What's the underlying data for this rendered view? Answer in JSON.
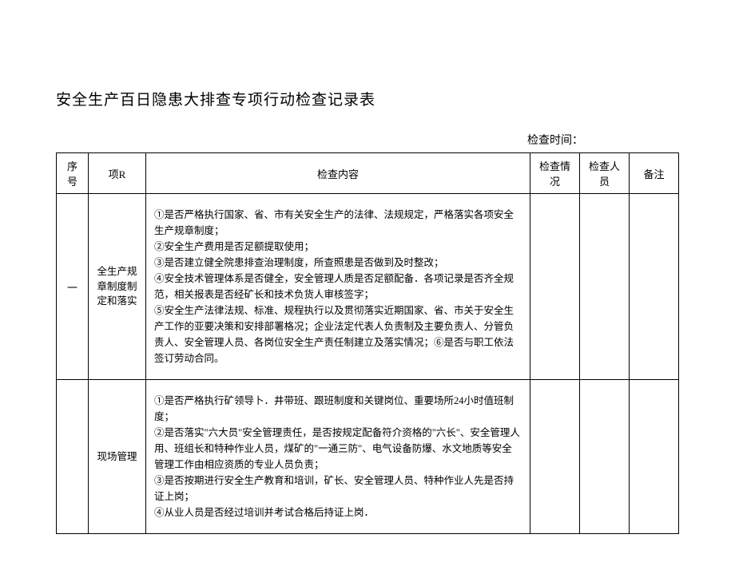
{
  "title": "安全生产百日隐患大排查专项行动检查记录表",
  "inspection_time_label": "检查时间：",
  "headers": {
    "seq": "序号",
    "item": "项R",
    "content": "检查内容",
    "status": "检查情况",
    "inspector": "检查人员",
    "note": "备注"
  },
  "rows": [
    {
      "seq": "一",
      "item": "全生产规章制度制定和落实",
      "content": "①是否严格执行国家、省、市有关安全生产的法律、法规规定，严格落实各项安全生产规章制度；\n②安全生产费用是否足额提取使用；\n③是否建立健全院患排查治理制度，所查照患是否做到及时整改；\n④安全技术管理体系是否健全，安全管理人质是否足额配备．各项记录是否齐全规范，相关报表是否经矿长和技术负货人审核签字；\n⑤安全生产法律法规、标准、规程执行以及贯彻落实近期国家、省、市关于安全生产工作的亚要决策和安排部署格况；企业法定代表人负责制及主要负责人、分管负责人、安全管理人员、各岗位安全生产责任制建立及落实情况；⑥是否与职工依法签订劳动合同。",
      "status": "",
      "inspector": "",
      "note": ""
    },
    {
      "seq": "",
      "item": "现场管理",
      "content": "①是否严格执行矿领导卜．井带班、跟班制度和关键岗位、重要场所24小时值班制度；\n②是否落实\"六大员\"安全管理责任，是否按规定配备符介资格的\"六长\"、安全管理人用、班组长和特种作业人员，煤矿的\"一通三防\"、电气设备防爆、水文地质等安全管理工作由相应资质的专业人员负责；\n③是否按期进行安全生产教育和培训，矿长、安全管理人员、特种作业人先是否持证上岗；\n④从业人员是否经过培训并考试合格后持证上岗．",
      "status": "",
      "inspector": "",
      "note": ""
    }
  ]
}
